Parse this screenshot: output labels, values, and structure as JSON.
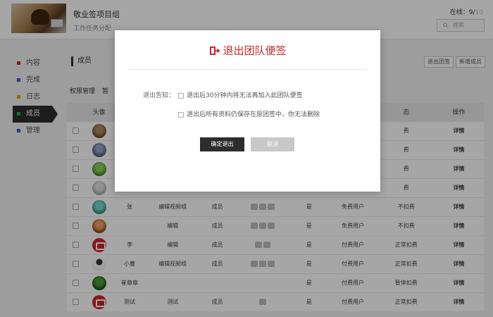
{
  "header": {
    "title": "敬业签项目组",
    "subtitle": "工作任务分配",
    "online_label": "在线：",
    "online_count": "9/",
    "online_total": "10",
    "search_placeholder": "搜索"
  },
  "sidebar": {
    "items": [
      {
        "label": "内容",
        "color": "#c9262b"
      },
      {
        "label": "完成",
        "color": "#3d5fc4"
      },
      {
        "label": "日志",
        "color": "#e4a11b"
      },
      {
        "label": "成员",
        "color": "#27a85b",
        "active": true
      },
      {
        "label": "管理",
        "color": "#3d5fc4"
      }
    ]
  },
  "main": {
    "section_title": "成员",
    "exit_team_button": "退出团签",
    "add_member_button": "新增成员",
    "tabs": [
      "权限管理",
      "暂"
    ],
    "columns": [
      "头像",
      "",
      "",
      "",
      "",
      "",
      "",
      "态",
      "操作"
    ],
    "rows": [
      {
        "avatar": "photo1",
        "name": "",
        "group": "",
        "role": "",
        "icons": 0,
        "yes": "",
        "user_type": "",
        "status": "费",
        "action": "详情"
      },
      {
        "avatar": "photo2",
        "name": "",
        "group": "",
        "role": "",
        "icons": 0,
        "yes": "",
        "user_type": "",
        "status": "费",
        "action": "详情"
      },
      {
        "avatar": "photo3",
        "name": "",
        "group": "",
        "role": "",
        "icons": 0,
        "yes": "",
        "user_type": "",
        "status": "费",
        "action": "详情"
      },
      {
        "avatar": "photo4",
        "name": "",
        "group": "",
        "role": "",
        "icons": 0,
        "yes": "",
        "user_type": "",
        "status": "费",
        "action": "详情"
      },
      {
        "avatar": "photo5",
        "name": "张",
        "group": "编辑视频组",
        "role": "成员",
        "icons": 3,
        "yes": "是",
        "user_type": "免费用户",
        "status": "不扣费",
        "action": "详情"
      },
      {
        "avatar": "photo6",
        "name": "",
        "group": "编辑",
        "role": "成员",
        "icons": 3,
        "yes": "是",
        "user_type": "免费用户",
        "status": "不扣费",
        "action": "详情"
      },
      {
        "avatar": "red",
        "name": "李",
        "group": "编辑",
        "role": "成员",
        "icons": 2,
        "yes": "是",
        "user_type": "付费用户",
        "status": "正常扣费",
        "action": "详情"
      },
      {
        "avatar": "person",
        "name": "小曹",
        "group": "编辑视频组",
        "role": "成员",
        "icons": 3,
        "yes": "是",
        "user_type": "付费用户",
        "status": "正常扣费",
        "action": "详情"
      },
      {
        "avatar": "tree",
        "name": "崔章章",
        "group": "",
        "role": "",
        "icons": 0,
        "yes": "是",
        "user_type": "付费用户",
        "status": "暂停扣费",
        "action": "详情"
      },
      {
        "avatar": "red",
        "name": "测试",
        "group": "测试",
        "role": "成员",
        "icons": 1,
        "yes": "是",
        "user_type": "付费用户",
        "status": "正常扣费",
        "action": "详情"
      }
    ]
  },
  "modal": {
    "title": "退出团队便签",
    "notice_label": "退出告知：",
    "option1": "退出后30分钟内将无法再加入此团队便签",
    "option2": "退出后所有资料仍保存在原团签中，你无法删除",
    "confirm_button": "确定退出",
    "cancel_button": "取消",
    "accent_color": "#c9262b"
  }
}
